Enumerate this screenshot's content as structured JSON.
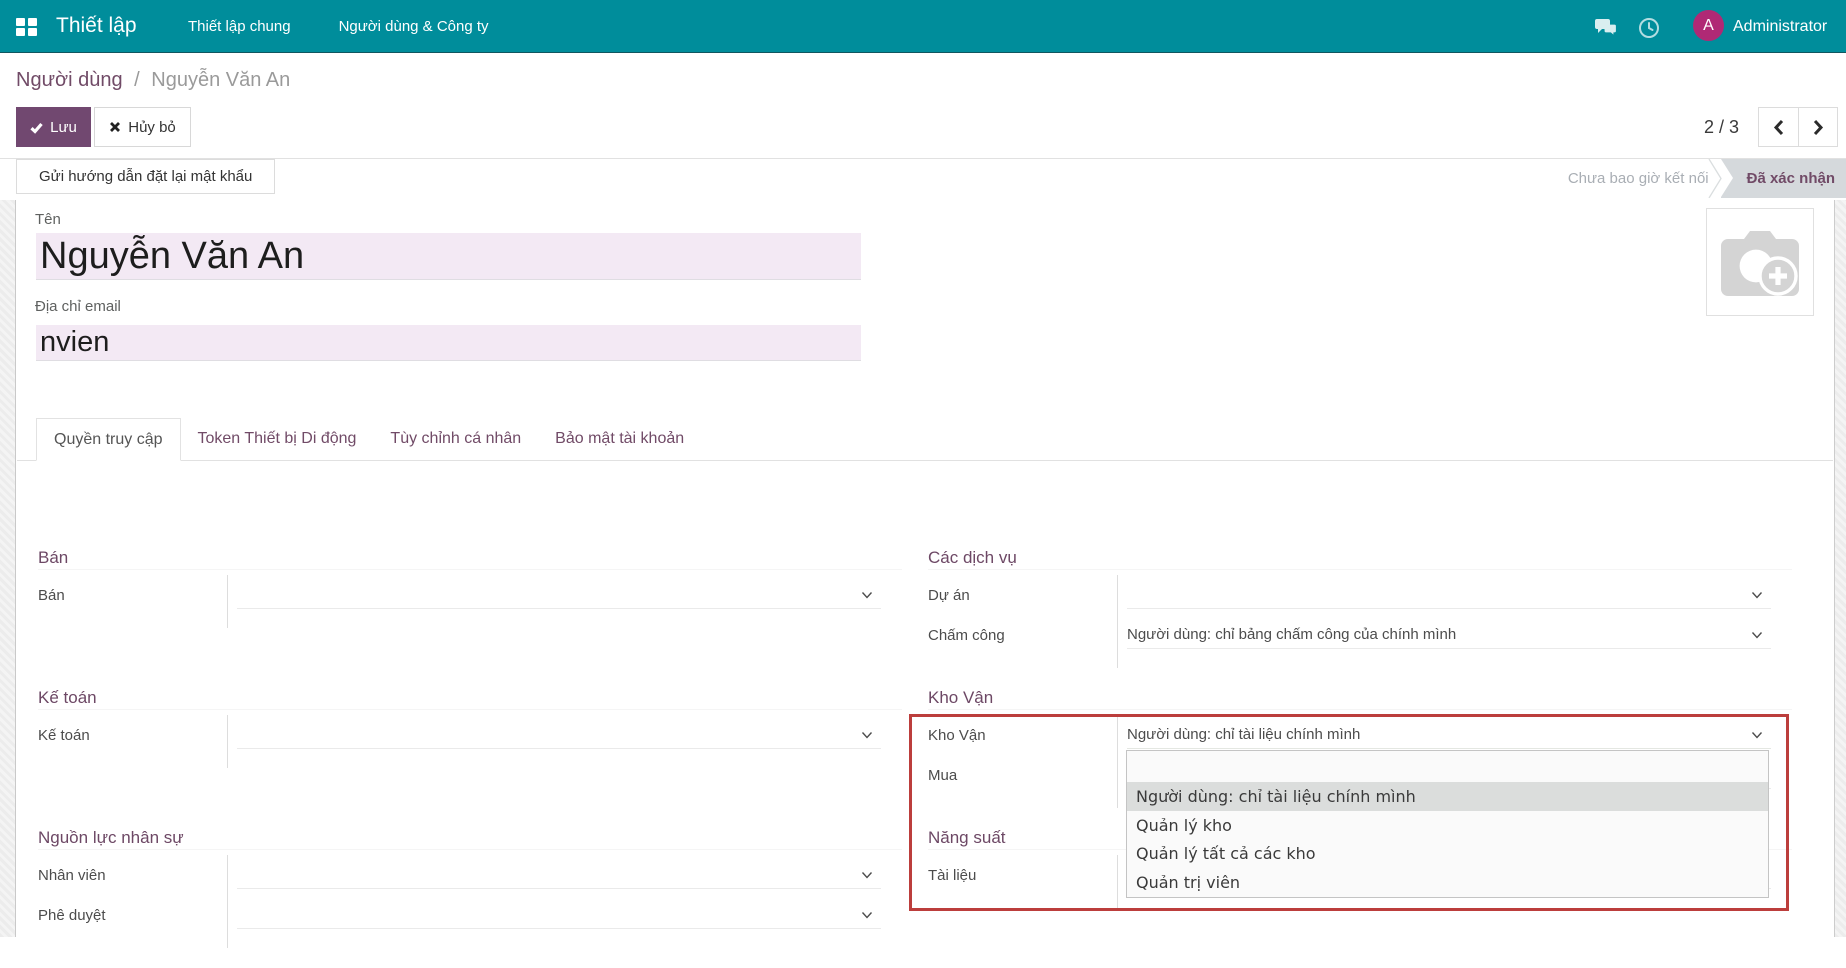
{
  "colors": {
    "teal": "#008d9b",
    "primary": "#714870",
    "highlight": "#f3e9f4",
    "red": "#bc3e3c",
    "avatar": "#b02975",
    "stage_active_bg": "#d5d9dc"
  },
  "navbar": {
    "app_title": "Thiết lập",
    "menus": [
      "Thiết lập chung",
      "Người dùng & Công ty"
    ],
    "user": "Administrator",
    "avatar_letter": "A"
  },
  "breadcrumb": {
    "parent": "Người dùng",
    "separator": "/",
    "current": "Nguyễn Văn An"
  },
  "actions": {
    "save": "Lưu",
    "discard": "Hủy bỏ",
    "pager": "2 / 3"
  },
  "statusbar": {
    "action_button": "Gửi hướng dẫn đặt lại mật khẩu",
    "stages": [
      {
        "label": "Chưa bao giờ kết nối",
        "active": false
      },
      {
        "label": "Đã xác nhận",
        "active": true
      }
    ]
  },
  "record": {
    "name_label": "Tên",
    "name": "Nguyễn Văn An",
    "email_label": "Địa chỉ email",
    "email": "nvien"
  },
  "tabs": [
    {
      "label": "Quyền truy cập",
      "active": true
    },
    {
      "label": "Token Thiết bị Di động",
      "active": false
    },
    {
      "label": "Tùy chỉnh cá nhân",
      "active": false
    },
    {
      "label": "Bảo mật tài khoản",
      "active": false
    }
  ],
  "groups": {
    "left": [
      {
        "title": "Bán",
        "fields": [
          {
            "name": "ban",
            "label": "Bán",
            "value": "",
            "caret": true
          }
        ]
      },
      {
        "title": "Kế toán",
        "fields": [
          {
            "name": "ke-toan",
            "label": "Kế toán",
            "value": "",
            "caret": true
          }
        ]
      },
      {
        "title": "Nguồn lực nhân sự",
        "fields": [
          {
            "name": "nhan-vien",
            "label": "Nhân viên",
            "value": "",
            "caret": true
          },
          {
            "name": "phe-duyet",
            "label": "Phê duyệt",
            "value": "",
            "caret": true
          }
        ]
      }
    ],
    "right": [
      {
        "title": "Các dịch vụ",
        "fields": [
          {
            "name": "du-an",
            "label": "Dự án",
            "value": "",
            "caret": true
          },
          {
            "name": "cham-cong",
            "label": "Chấm công",
            "value": "Người dùng: chỉ bảng chấm công của chính mình",
            "caret": true
          }
        ]
      },
      {
        "title": "Kho Vận",
        "fields": [
          {
            "name": "kho-van",
            "label": "Kho Vận",
            "value": "Người dùng: chỉ tài liệu chính mình",
            "caret": true,
            "focused": true
          },
          {
            "name": "mua",
            "label": "Mua",
            "value": "",
            "caret": false
          }
        ]
      },
      {
        "title": "Năng suất",
        "fields": [
          {
            "name": "tai-lieu",
            "label": "Tài liệu",
            "value": "",
            "caret": false
          }
        ]
      }
    ]
  },
  "dropdown": {
    "options": [
      "",
      "Người dùng: chỉ tài liệu chính mình",
      "Quản lý kho",
      "Quản lý tất cả các kho",
      "Quản trị viên"
    ],
    "selected": "Người dùng: chỉ tài liệu chính mình"
  }
}
